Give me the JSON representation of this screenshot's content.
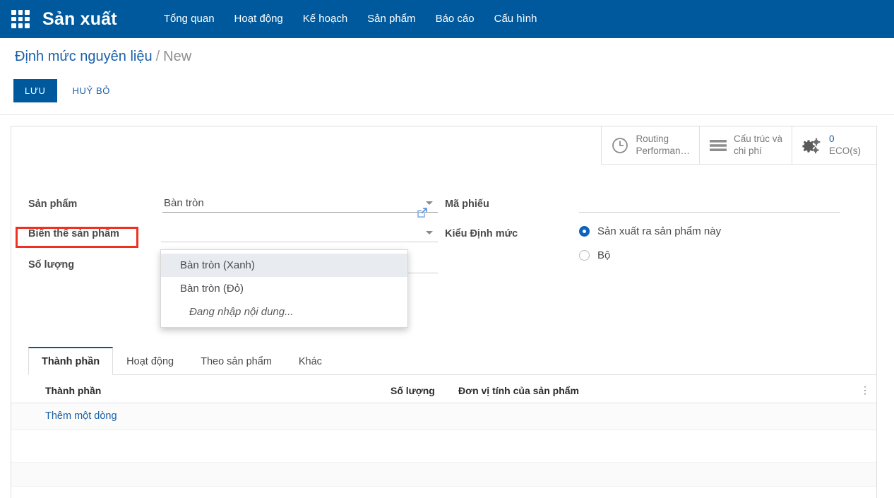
{
  "browser": {
    "strip_present": true
  },
  "navbar": {
    "apps_icon": "apps-grid-icon",
    "brand": "Sản xuất",
    "links": [
      {
        "label": "Tổng quan"
      },
      {
        "label": "Hoạt động"
      },
      {
        "label": "Kế hoạch"
      },
      {
        "label": "Sản phẩm"
      },
      {
        "label": "Báo cáo"
      },
      {
        "label": "Cấu hình"
      }
    ],
    "bg_color": "#00599c"
  },
  "breadcrumb": {
    "root": "Định mức nguyên liệu",
    "separator": "/",
    "current": "New"
  },
  "controls": {
    "save_label": "LƯU",
    "discard_label": "HUỶ BỎ"
  },
  "smart_buttons": [
    {
      "icon": "clock-icon",
      "line1": "Routing",
      "line2": "Performan…"
    },
    {
      "icon": "list-lines-icon",
      "line1": "Cấu trúc và",
      "line2": "chi phí"
    },
    {
      "icon": "gears-icon",
      "count": "0",
      "line2": "ECO(s)"
    }
  ],
  "form": {
    "left": {
      "product": {
        "label": "Sản phẩm",
        "value": "Bàn tròn",
        "placeholder": ""
      },
      "variant": {
        "label": "Biến thể sản phẩm",
        "value": "",
        "placeholder": ""
      },
      "quantity": {
        "label": "Số lượng",
        "value": "",
        "placeholder": ""
      },
      "external_link_icon": "external-link-icon"
    },
    "right": {
      "reference": {
        "label": "Mã phiếu",
        "value": "",
        "placeholder": ""
      },
      "bom_type": {
        "label": "Kiểu Định mức",
        "options": [
          {
            "label": "Sản xuất ra sản phẩm này",
            "selected": true
          },
          {
            "label": "Bộ",
            "selected": false
          }
        ]
      }
    },
    "highlight_color": "#ef3124"
  },
  "dropdown": {
    "items": [
      {
        "label": "Bàn tròn (Xanh)",
        "active": true
      },
      {
        "label": "Bàn tròn (Đỏ)",
        "active": false
      }
    ],
    "hint": "Đang nhập nội dung..."
  },
  "tabs": [
    {
      "label": "Thành phần",
      "selected": true
    },
    {
      "label": "Hoạt động",
      "selected": false
    },
    {
      "label": "Theo sản phẩm",
      "selected": false
    },
    {
      "label": "Khác",
      "selected": false
    }
  ],
  "lines_table": {
    "columns": [
      "Thành phần",
      "Số lượng",
      "Đơn vị tính của sản phẩm"
    ],
    "options_icon": "kebab-menu-icon",
    "add_row_label": "Thêm một dòng",
    "rows": []
  }
}
